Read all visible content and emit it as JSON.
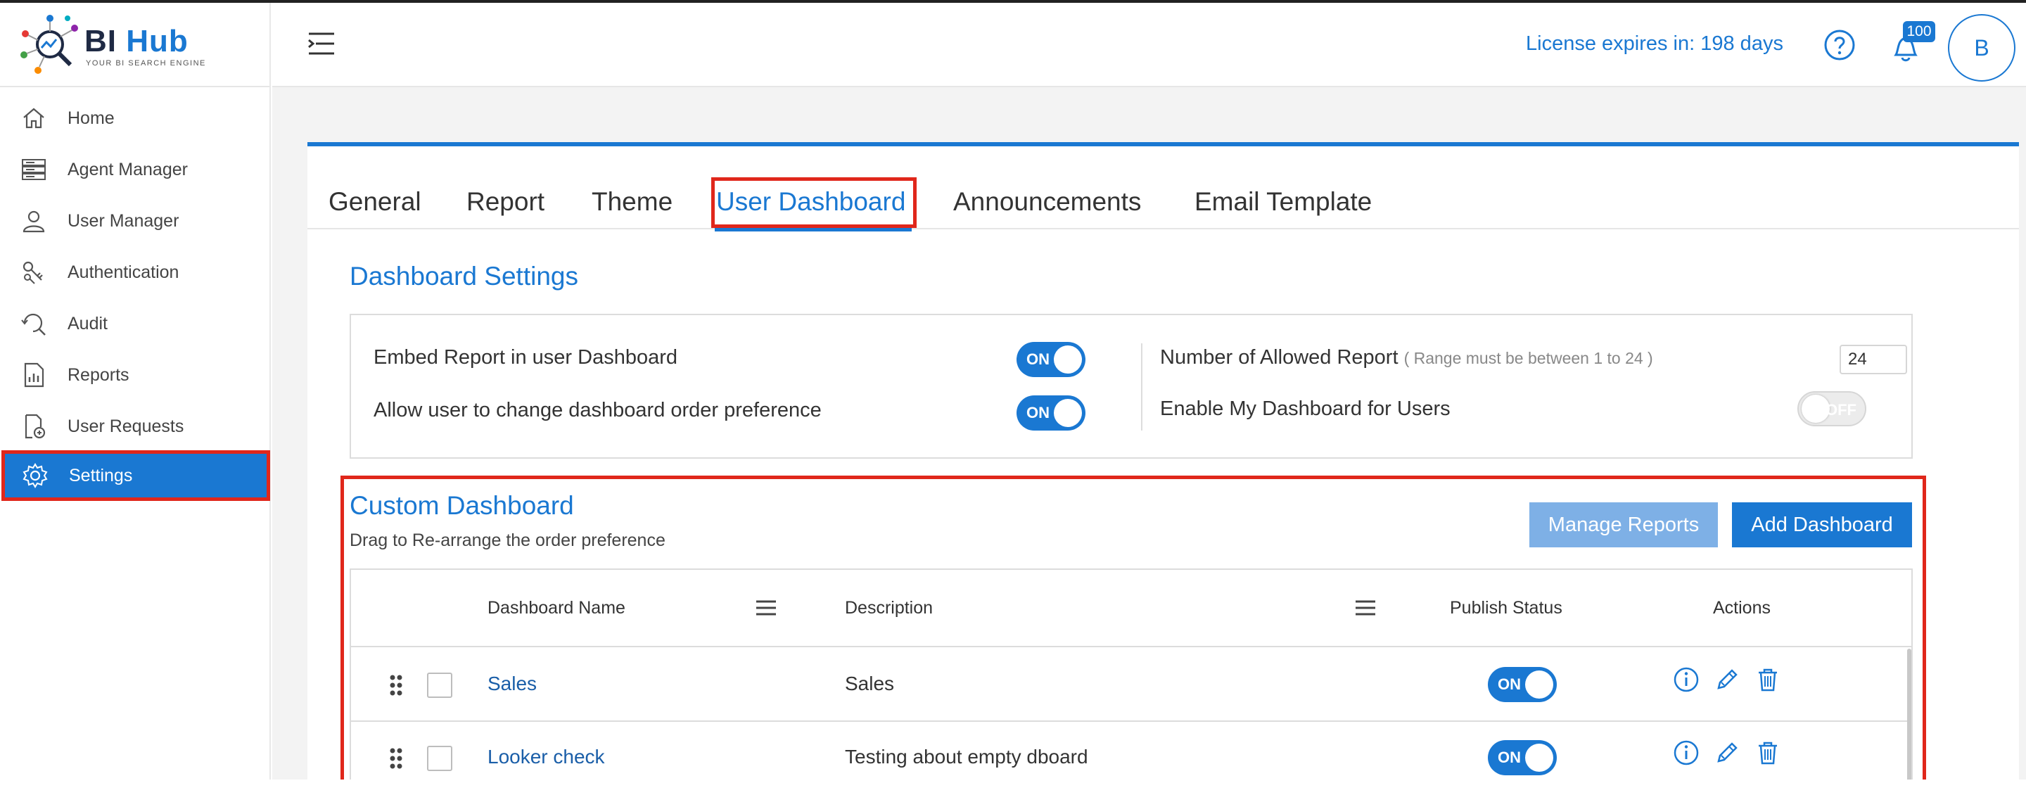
{
  "app": {
    "logo_brand_first": "BI",
    "logo_brand_second": "Hub",
    "logo_tagline": "YOUR BI SEARCH ENGINE"
  },
  "sidebar": {
    "items": [
      {
        "label": "Home",
        "icon": "home-icon"
      },
      {
        "label": "Agent Manager",
        "icon": "server-icon"
      },
      {
        "label": "User Manager",
        "icon": "user-icon"
      },
      {
        "label": "Authentication",
        "icon": "keys-icon"
      },
      {
        "label": "Audit",
        "icon": "audit-search-icon"
      },
      {
        "label": "Reports",
        "icon": "report-chart-icon"
      },
      {
        "label": "User Requests",
        "icon": "request-document-icon"
      },
      {
        "label": "Settings",
        "icon": "gear-icon",
        "active": true
      }
    ]
  },
  "header": {
    "license_text": "License expires in: 198 days",
    "notification_count": "100",
    "avatar_initial": "B"
  },
  "tabs": [
    {
      "label": "General"
    },
    {
      "label": "Report"
    },
    {
      "label": "Theme"
    },
    {
      "label": "User Dashboard",
      "active": true
    },
    {
      "label": "Announcements"
    },
    {
      "label": "Email Template"
    }
  ],
  "dashboard_settings": {
    "title": "Dashboard Settings",
    "embed_label": "Embed Report in user Dashboard",
    "embed_state": "ON",
    "order_label": "Allow user to change dashboard order preference",
    "order_state": "ON",
    "allowed_label": "Number of Allowed Report",
    "allowed_hint": "( Range must be between 1 to 24 )",
    "allowed_value": "24",
    "my_dashboard_label": "Enable My Dashboard for Users",
    "my_dashboard_state": "OFF"
  },
  "custom_dashboard": {
    "title": "Custom Dashboard",
    "subtitle": "Drag to Re-arrange the order preference",
    "manage_button": "Manage Reports",
    "add_button": "Add Dashboard",
    "columns": {
      "name": "Dashboard Name",
      "description": "Description",
      "publish": "Publish Status",
      "actions": "Actions"
    },
    "rows": [
      {
        "name": "Sales",
        "description": "Sales",
        "publish": "ON"
      },
      {
        "name": "Looker check",
        "description": "Testing about empty dboard",
        "publish": "ON"
      }
    ]
  },
  "colors": {
    "accent": "#1a78d2",
    "highlight_border": "#e0271b",
    "manage_button_bg": "#7eb0e6"
  }
}
